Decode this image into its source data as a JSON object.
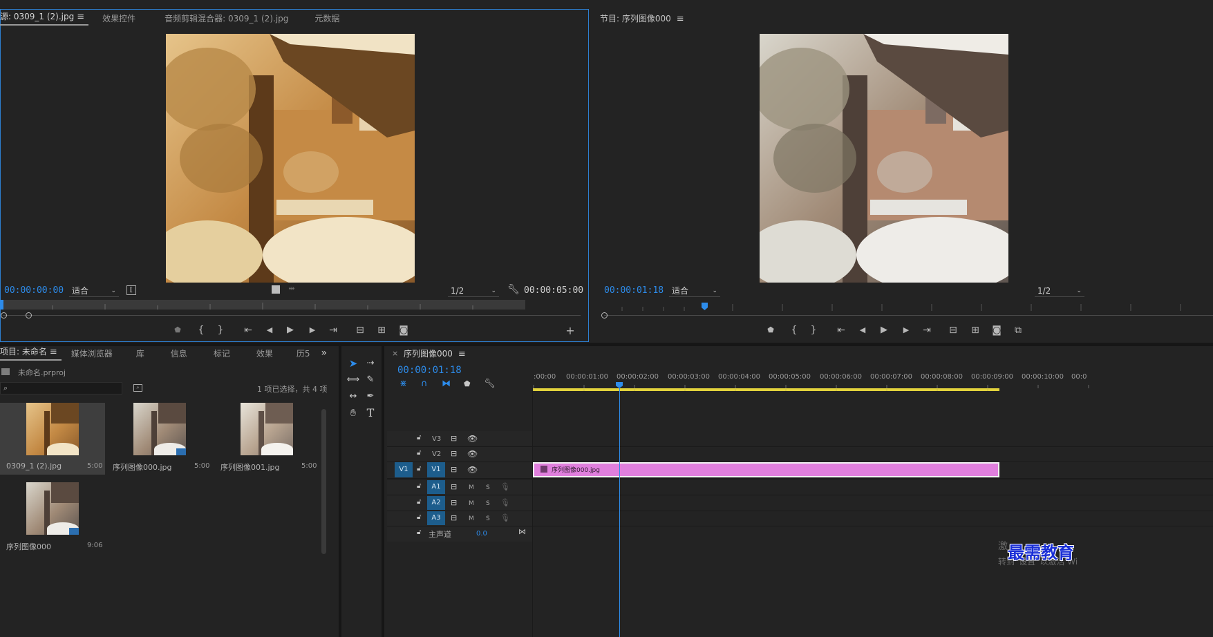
{
  "source_monitor": {
    "tabs": [
      {
        "label": "源: 0309_1 (2).jpg"
      },
      {
        "label": "效果控件"
      },
      {
        "label": "音频剪辑混合器: 0309_1 (2).jpg"
      },
      {
        "label": "元数据"
      }
    ],
    "timecode_current": "00:00:00:00",
    "fit_label": "适合",
    "resolution": "1/2",
    "timecode_duration": "00:00:05:00"
  },
  "program_monitor": {
    "title": "节目: 序列图像000",
    "timecode_current": "00:00:01:18",
    "fit_label": "适合",
    "resolution": "1/2"
  },
  "project_panel": {
    "tabs": [
      {
        "label": "项目: 未命名"
      },
      {
        "label": "媒体浏览器"
      },
      {
        "label": "库"
      },
      {
        "label": "信息"
      },
      {
        "label": "标记"
      },
      {
        "label": "效果"
      },
      {
        "label": "历5"
      }
    ],
    "overflow": "»",
    "project_file": "未命名.prproj",
    "search_placeholder": "",
    "selection_status": "1 项已选择，共 4 项",
    "items": [
      {
        "name": "0309_1 (2).jpg",
        "duration": "5:00"
      },
      {
        "name": "序列图像000.jpg",
        "duration": "5:00"
      },
      {
        "name": "序列图像001.jpg",
        "duration": "5:00"
      },
      {
        "name": "序列图像000",
        "duration": "9:06"
      }
    ]
  },
  "timeline": {
    "close": "×",
    "title": "序列图像000",
    "timecode": "00:00:01:18",
    "ruler": [
      ":00:00",
      "00:00:01:00",
      "00:00:02:00",
      "00:00:03:00",
      "00:00:04:00",
      "00:00:05:00",
      "00:00:06:00",
      "00:00:07:00",
      "00:00:08:00",
      "00:00:09:00",
      "00:00:10:00",
      "00:0"
    ],
    "tracks": {
      "v3": "V3",
      "v2": "V2",
      "v1": "V1",
      "v1_src": "V1",
      "a1": "A1",
      "a2": "A2",
      "a3": "A3",
      "m": "M",
      "s": "S"
    },
    "master": {
      "label": "主声道",
      "value": "0.0"
    },
    "clip_name": "序列图像000.jpg"
  },
  "watermark": {
    "activate_line1": "激",
    "activate_line2": "转到“设置”以激活 Wi",
    "brand": "最需教育"
  },
  "colors": {
    "accent_blue": "#2d8ceb",
    "clip_pink": "#e07fdd",
    "work_area_yellow": "#e2d23c",
    "active_border": "#2d7fd1"
  }
}
